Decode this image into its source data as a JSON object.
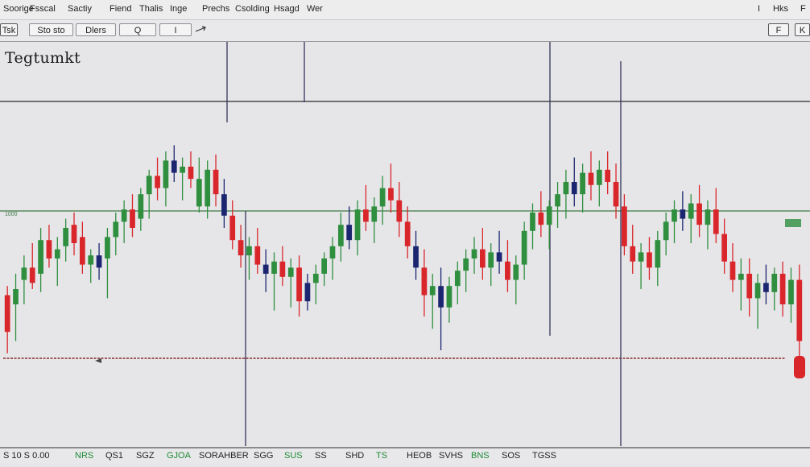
{
  "menubar": {
    "items": [
      "Soorige",
      "Fsscal",
      "Sactiy",
      "Fiend",
      "Thalis",
      "Inge",
      "Prechs",
      "Csolding",
      "Hsagd",
      "Wer",
      "I",
      "Hks",
      "F"
    ]
  },
  "toolbar": {
    "left_button": "Tsk",
    "buttons": [
      "Sto sto",
      "Dlers",
      "Q",
      "I"
    ],
    "right_buttons": [
      "F",
      "K"
    ]
  },
  "chart": {
    "title": "Tegtumkt",
    "price_tag": "1000"
  },
  "statusbar": {
    "items": [
      "S 10 S 0.00",
      "NRS",
      "QS1",
      "SGZ",
      "GJOA",
      "SORAHBER",
      "SGG",
      "SUS",
      "SS",
      "SHD",
      "TS",
      "HEOB",
      "SVHS",
      "BNS",
      "SOS",
      "TGSS"
    ]
  },
  "colors": {
    "background": "#e6e6e9",
    "bull_candle": "#2f8f3e",
    "bear_candle": "#d9262b",
    "navy_candle": "#1c2670",
    "support_line": "#3e7a44",
    "dashed_line": "#8a2a2a",
    "status_green": "#1d8a35"
  },
  "chart_data": {
    "type": "candlestick",
    "title": "Tegtumkt",
    "xlabel": "",
    "ylabel": "",
    "ylim": [
      0,
      1
    ],
    "grid": false,
    "candles": [
      {
        "o": 0.33,
        "h": 0.36,
        "l": 0.14,
        "c": 0.21,
        "dir": "down"
      },
      {
        "o": 0.3,
        "h": 0.4,
        "l": 0.18,
        "c": 0.35,
        "dir": "up"
      },
      {
        "o": 0.38,
        "h": 0.46,
        "l": 0.3,
        "c": 0.42,
        "dir": "up"
      },
      {
        "o": 0.42,
        "h": 0.5,
        "l": 0.35,
        "c": 0.37,
        "dir": "down"
      },
      {
        "o": 0.4,
        "h": 0.55,
        "l": 0.34,
        "c": 0.51,
        "dir": "up"
      },
      {
        "o": 0.51,
        "h": 0.56,
        "l": 0.42,
        "c": 0.45,
        "dir": "down"
      },
      {
        "o": 0.45,
        "h": 0.52,
        "l": 0.36,
        "c": 0.48,
        "dir": "up"
      },
      {
        "o": 0.49,
        "h": 0.58,
        "l": 0.44,
        "c": 0.55,
        "dir": "up"
      },
      {
        "o": 0.56,
        "h": 0.6,
        "l": 0.46,
        "c": 0.5,
        "dir": "down"
      },
      {
        "o": 0.52,
        "h": 0.57,
        "l": 0.4,
        "c": 0.43,
        "dir": "down"
      },
      {
        "o": 0.43,
        "h": 0.48,
        "l": 0.37,
        "c": 0.46,
        "dir": "up"
      },
      {
        "o": 0.46,
        "h": 0.5,
        "l": 0.38,
        "c": 0.42,
        "dir": "navy"
      },
      {
        "o": 0.45,
        "h": 0.55,
        "l": 0.32,
        "c": 0.52,
        "dir": "up"
      },
      {
        "o": 0.52,
        "h": 0.6,
        "l": 0.46,
        "c": 0.57,
        "dir": "up"
      },
      {
        "o": 0.57,
        "h": 0.64,
        "l": 0.5,
        "c": 0.61,
        "dir": "up"
      },
      {
        "o": 0.61,
        "h": 0.66,
        "l": 0.52,
        "c": 0.55,
        "dir": "down"
      },
      {
        "o": 0.58,
        "h": 0.68,
        "l": 0.54,
        "c": 0.66,
        "dir": "up"
      },
      {
        "o": 0.66,
        "h": 0.74,
        "l": 0.58,
        "c": 0.72,
        "dir": "up"
      },
      {
        "o": 0.72,
        "h": 0.78,
        "l": 0.64,
        "c": 0.68,
        "dir": "down"
      },
      {
        "o": 0.68,
        "h": 0.8,
        "l": 0.62,
        "c": 0.77,
        "dir": "up"
      },
      {
        "o": 0.77,
        "h": 0.82,
        "l": 0.7,
        "c": 0.73,
        "dir": "navy"
      },
      {
        "o": 0.73,
        "h": 0.78,
        "l": 0.64,
        "c": 0.75,
        "dir": "up"
      },
      {
        "o": 0.75,
        "h": 0.8,
        "l": 0.68,
        "c": 0.71,
        "dir": "down"
      },
      {
        "o": 0.71,
        "h": 0.78,
        "l": 0.6,
        "c": 0.62,
        "dir": "up"
      },
      {
        "o": 0.62,
        "h": 0.77,
        "l": 0.58,
        "c": 0.74,
        "dir": "up"
      },
      {
        "o": 0.74,
        "h": 0.79,
        "l": 0.62,
        "c": 0.66,
        "dir": "down"
      },
      {
        "o": 0.66,
        "h": 0.71,
        "l": 0.55,
        "c": 0.59,
        "dir": "navy"
      },
      {
        "o": 0.59,
        "h": 0.64,
        "l": 0.48,
        "c": 0.51,
        "dir": "down"
      },
      {
        "o": 0.51,
        "h": 0.56,
        "l": 0.42,
        "c": 0.46,
        "dir": "down"
      },
      {
        "o": 0.46,
        "h": 0.52,
        "l": 0.38,
        "c": 0.49,
        "dir": "up"
      },
      {
        "o": 0.49,
        "h": 0.55,
        "l": 0.4,
        "c": 0.43,
        "dir": "down"
      },
      {
        "o": 0.43,
        "h": 0.48,
        "l": 0.34,
        "c": 0.4,
        "dir": "navy"
      },
      {
        "o": 0.4,
        "h": 0.47,
        "l": 0.28,
        "c": 0.44,
        "dir": "up"
      },
      {
        "o": 0.44,
        "h": 0.49,
        "l": 0.36,
        "c": 0.39,
        "dir": "down"
      },
      {
        "o": 0.39,
        "h": 0.45,
        "l": 0.29,
        "c": 0.42,
        "dir": "up"
      },
      {
        "o": 0.42,
        "h": 0.46,
        "l": 0.26,
        "c": 0.31,
        "dir": "down"
      },
      {
        "o": 0.31,
        "h": 0.4,
        "l": 0.28,
        "c": 0.37,
        "dir": "navy"
      },
      {
        "o": 0.37,
        "h": 0.43,
        "l": 0.3,
        "c": 0.4,
        "dir": "up"
      },
      {
        "o": 0.4,
        "h": 0.47,
        "l": 0.36,
        "c": 0.45,
        "dir": "up"
      },
      {
        "o": 0.45,
        "h": 0.52,
        "l": 0.38,
        "c": 0.49,
        "dir": "up"
      },
      {
        "o": 0.49,
        "h": 0.6,
        "l": 0.44,
        "c": 0.56,
        "dir": "up"
      },
      {
        "o": 0.56,
        "h": 0.62,
        "l": 0.48,
        "c": 0.51,
        "dir": "navy"
      },
      {
        "o": 0.51,
        "h": 0.64,
        "l": 0.46,
        "c": 0.61,
        "dir": "up"
      },
      {
        "o": 0.61,
        "h": 0.69,
        "l": 0.54,
        "c": 0.57,
        "dir": "down"
      },
      {
        "o": 0.57,
        "h": 0.65,
        "l": 0.5,
        "c": 0.62,
        "dir": "up"
      },
      {
        "o": 0.62,
        "h": 0.72,
        "l": 0.56,
        "c": 0.68,
        "dir": "up"
      },
      {
        "o": 0.68,
        "h": 0.76,
        "l": 0.6,
        "c": 0.64,
        "dir": "down"
      },
      {
        "o": 0.64,
        "h": 0.7,
        "l": 0.52,
        "c": 0.57,
        "dir": "down"
      },
      {
        "o": 0.57,
        "h": 0.62,
        "l": 0.45,
        "c": 0.49,
        "dir": "down"
      },
      {
        "o": 0.49,
        "h": 0.54,
        "l": 0.38,
        "c": 0.42,
        "dir": "navy"
      },
      {
        "o": 0.42,
        "h": 0.48,
        "l": 0.26,
        "c": 0.33,
        "dir": "down"
      },
      {
        "o": 0.33,
        "h": 0.4,
        "l": 0.22,
        "c": 0.36,
        "dir": "up"
      },
      {
        "o": 0.36,
        "h": 0.42,
        "l": 0.15,
        "c": 0.29,
        "dir": "navy"
      },
      {
        "o": 0.29,
        "h": 0.39,
        "l": 0.24,
        "c": 0.36,
        "dir": "up"
      },
      {
        "o": 0.36,
        "h": 0.44,
        "l": 0.3,
        "c": 0.41,
        "dir": "up"
      },
      {
        "o": 0.41,
        "h": 0.48,
        "l": 0.34,
        "c": 0.45,
        "dir": "up"
      },
      {
        "o": 0.45,
        "h": 0.52,
        "l": 0.4,
        "c": 0.48,
        "dir": "up"
      },
      {
        "o": 0.48,
        "h": 0.55,
        "l": 0.38,
        "c": 0.42,
        "dir": "down"
      },
      {
        "o": 0.42,
        "h": 0.5,
        "l": 0.36,
        "c": 0.47,
        "dir": "up"
      },
      {
        "o": 0.47,
        "h": 0.54,
        "l": 0.4,
        "c": 0.44,
        "dir": "navy"
      },
      {
        "o": 0.44,
        "h": 0.51,
        "l": 0.34,
        "c": 0.38,
        "dir": "down"
      },
      {
        "o": 0.38,
        "h": 0.46,
        "l": 0.3,
        "c": 0.43,
        "dir": "up"
      },
      {
        "o": 0.43,
        "h": 0.57,
        "l": 0.38,
        "c": 0.54,
        "dir": "up"
      },
      {
        "o": 0.54,
        "h": 0.63,
        "l": 0.48,
        "c": 0.6,
        "dir": "up"
      },
      {
        "o": 0.6,
        "h": 0.67,
        "l": 0.52,
        "c": 0.56,
        "dir": "down"
      },
      {
        "o": 0.56,
        "h": 0.64,
        "l": 0.48,
        "c": 0.62,
        "dir": "up"
      },
      {
        "o": 0.62,
        "h": 0.7,
        "l": 0.55,
        "c": 0.66,
        "dir": "up"
      },
      {
        "o": 0.66,
        "h": 0.74,
        "l": 0.58,
        "c": 0.7,
        "dir": "up"
      },
      {
        "o": 0.7,
        "h": 0.78,
        "l": 0.62,
        "c": 0.66,
        "dir": "navy"
      },
      {
        "o": 0.66,
        "h": 0.76,
        "l": 0.6,
        "c": 0.73,
        "dir": "up"
      },
      {
        "o": 0.73,
        "h": 0.8,
        "l": 0.64,
        "c": 0.69,
        "dir": "down"
      },
      {
        "o": 0.69,
        "h": 0.77,
        "l": 0.62,
        "c": 0.74,
        "dir": "up"
      },
      {
        "o": 0.74,
        "h": 0.8,
        "l": 0.66,
        "c": 0.7,
        "dir": "down"
      },
      {
        "o": 0.7,
        "h": 0.76,
        "l": 0.58,
        "c": 0.62,
        "dir": "down"
      },
      {
        "o": 0.62,
        "h": 0.66,
        "l": 0.46,
        "c": 0.49,
        "dir": "down"
      },
      {
        "o": 0.49,
        "h": 0.56,
        "l": 0.4,
        "c": 0.44,
        "dir": "down"
      },
      {
        "o": 0.44,
        "h": 0.5,
        "l": 0.35,
        "c": 0.47,
        "dir": "up"
      },
      {
        "o": 0.47,
        "h": 0.52,
        "l": 0.38,
        "c": 0.42,
        "dir": "down"
      },
      {
        "o": 0.42,
        "h": 0.54,
        "l": 0.36,
        "c": 0.51,
        "dir": "up"
      },
      {
        "o": 0.51,
        "h": 0.6,
        "l": 0.46,
        "c": 0.57,
        "dir": "up"
      },
      {
        "o": 0.57,
        "h": 0.64,
        "l": 0.5,
        "c": 0.61,
        "dir": "up"
      },
      {
        "o": 0.61,
        "h": 0.67,
        "l": 0.54,
        "c": 0.58,
        "dir": "navy"
      },
      {
        "o": 0.58,
        "h": 0.66,
        "l": 0.5,
        "c": 0.63,
        "dir": "up"
      },
      {
        "o": 0.63,
        "h": 0.69,
        "l": 0.52,
        "c": 0.56,
        "dir": "down"
      },
      {
        "o": 0.56,
        "h": 0.64,
        "l": 0.48,
        "c": 0.61,
        "dir": "up"
      },
      {
        "o": 0.61,
        "h": 0.68,
        "l": 0.5,
        "c": 0.53,
        "dir": "down"
      },
      {
        "o": 0.53,
        "h": 0.58,
        "l": 0.4,
        "c": 0.44,
        "dir": "down"
      },
      {
        "o": 0.44,
        "h": 0.5,
        "l": 0.34,
        "c": 0.38,
        "dir": "down"
      },
      {
        "o": 0.38,
        "h": 0.45,
        "l": 0.28,
        "c": 0.4,
        "dir": "up"
      },
      {
        "o": 0.4,
        "h": 0.45,
        "l": 0.26,
        "c": 0.32,
        "dir": "down"
      },
      {
        "o": 0.32,
        "h": 0.4,
        "l": 0.22,
        "c": 0.37,
        "dir": "up"
      },
      {
        "o": 0.37,
        "h": 0.43,
        "l": 0.3,
        "c": 0.34,
        "dir": "navy"
      },
      {
        "o": 0.34,
        "h": 0.42,
        "l": 0.28,
        "c": 0.4,
        "dir": "up"
      },
      {
        "o": 0.4,
        "h": 0.44,
        "l": 0.26,
        "c": 0.3,
        "dir": "down"
      },
      {
        "o": 0.3,
        "h": 0.42,
        "l": 0.24,
        "c": 0.38,
        "dir": "up"
      },
      {
        "o": 0.38,
        "h": 0.43,
        "l": 0.12,
        "c": 0.18,
        "dir": "down"
      }
    ]
  }
}
